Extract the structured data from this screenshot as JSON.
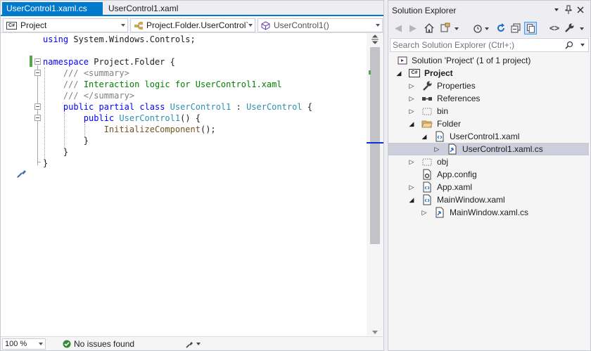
{
  "editor": {
    "tabs": [
      {
        "label": "UserControl1.xaml.cs",
        "active": true
      },
      {
        "label": "UserControl1.xaml",
        "active": false
      }
    ],
    "nav": {
      "project": "Project",
      "class": "Project.Folder.UserControl`",
      "member": "UserControl1()"
    },
    "code_lines": [
      "using System.Windows.Controls;",
      "",
      "namespace Project.Folder {",
      "    /// <summary>",
      "    /// Interaction logic for UserControl1.xaml",
      "    /// </summary>",
      "    public partial class UserControl1 : UserControl {",
      "        public UserControl1() {",
      "            InitializeComponent();",
      "        }",
      "    }",
      "}"
    ],
    "status": {
      "zoom": "100 %",
      "issues": "No issues found"
    }
  },
  "solution_explorer": {
    "title": "Solution Explorer",
    "search_placeholder": "Search Solution Explorer (Ctrl+;)",
    "tree": [
      {
        "label": "Solution 'Project' (1 of 1 project)",
        "icon": "solution-icon",
        "depth": 0,
        "expander": "none"
      },
      {
        "label": "Project",
        "icon": "csharp-project-icon",
        "depth": 0,
        "expander": "expanded",
        "bold": true
      },
      {
        "label": "Properties",
        "icon": "wrench-icon",
        "depth": 1,
        "expander": "collapsed"
      },
      {
        "label": "References",
        "icon": "references-icon",
        "depth": 1,
        "expander": "collapsed"
      },
      {
        "label": "bin",
        "icon": "hidden-folder-icon",
        "depth": 1,
        "expander": "collapsed"
      },
      {
        "label": "Folder",
        "icon": "folder-icon",
        "depth": 1,
        "expander": "expanded"
      },
      {
        "label": "UserControl1.xaml",
        "icon": "xaml-file-icon",
        "depth": 2,
        "expander": "expanded"
      },
      {
        "label": "UserControl1.xaml.cs",
        "icon": "cs-file-icon",
        "depth": 3,
        "expander": "collapsed",
        "selected": true
      },
      {
        "label": "obj",
        "icon": "hidden-folder-icon",
        "depth": 1,
        "expander": "collapsed"
      },
      {
        "label": "App.config",
        "icon": "config-file-icon",
        "depth": 1,
        "expander": "none"
      },
      {
        "label": "App.xaml",
        "icon": "xaml-file-icon",
        "depth": 1,
        "expander": "collapsed"
      },
      {
        "label": "MainWindow.xaml",
        "icon": "xaml-file-icon",
        "depth": 1,
        "expander": "expanded"
      },
      {
        "label": "MainWindow.xaml.cs",
        "icon": "cs-file-icon",
        "depth": 2,
        "expander": "collapsed"
      }
    ]
  },
  "colors": {
    "accent": "#007acc",
    "keyword": "#0000ff",
    "type": "#2b91af",
    "comment": "#008000",
    "doc_tag": "#808080",
    "selection": "#cccedb"
  }
}
